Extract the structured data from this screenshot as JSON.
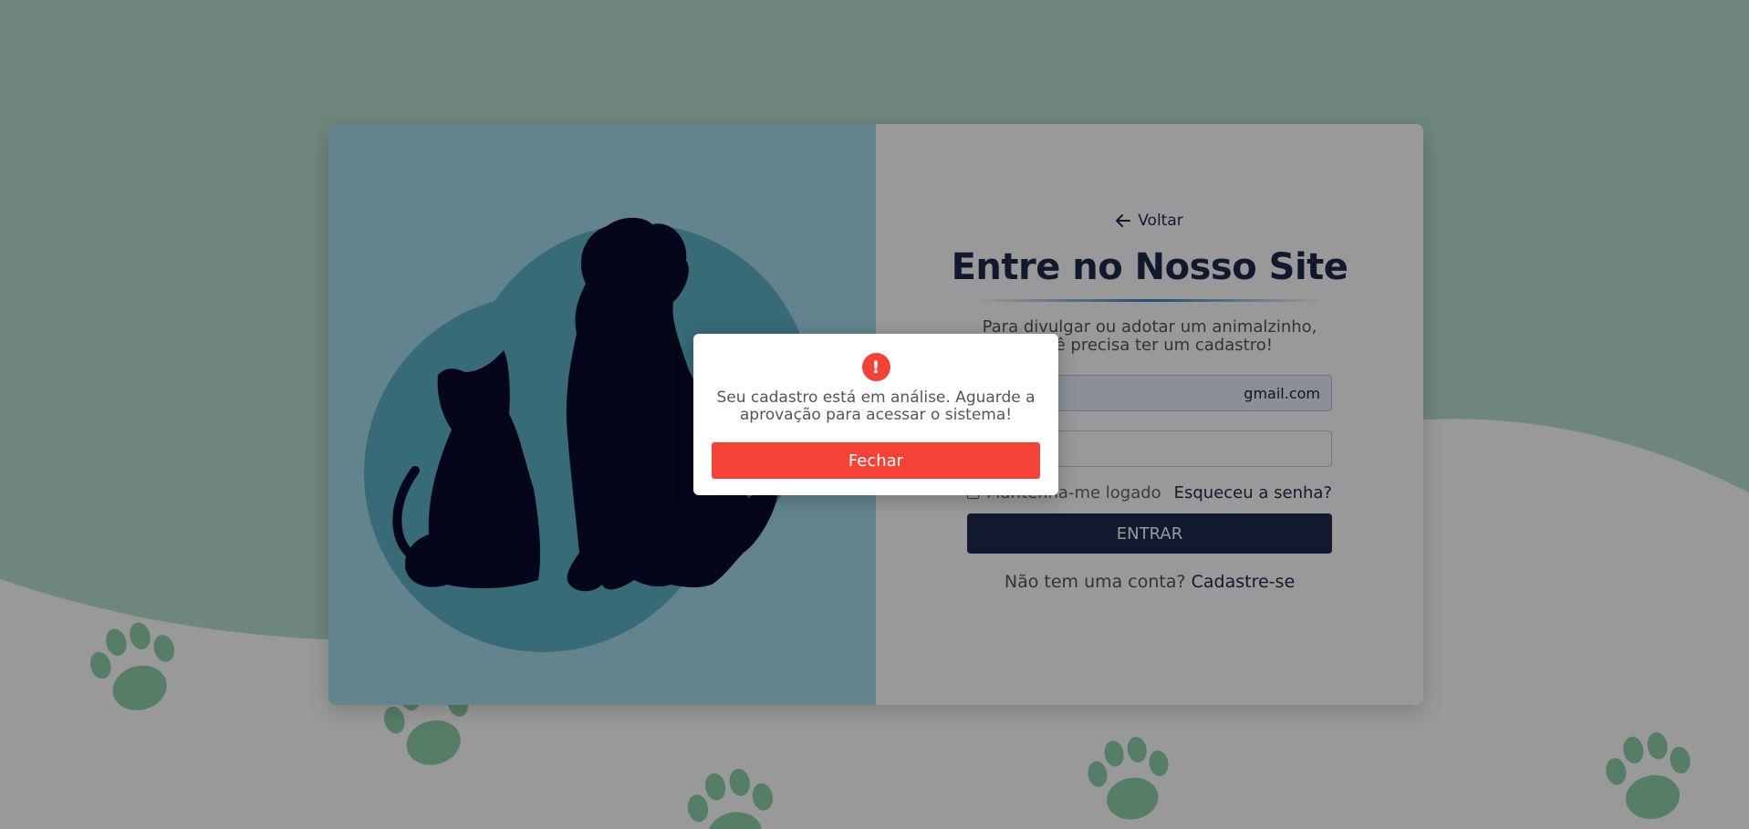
{
  "colors": {
    "wave": "#b8e0cf",
    "paw": "#8fd1ab",
    "card_left_bg": "#a7ddeb",
    "circle": "#5ab3c6",
    "silhouette": "#0a0a2e",
    "brand_navy": "#1b2a4e",
    "alert_red": "#f44336"
  },
  "login": {
    "back_label": "Voltar",
    "back_icon": "arrow-left-icon",
    "title": "Entre no Nosso Site",
    "subtitle": "Para divulgar ou adotar um animalzinho, você precisa ter um cadastro!",
    "email_value": "gmail.com",
    "password_value": "",
    "remember_label": "Mantenha-me logado",
    "forgot_label": "Esqueceu a senha?",
    "enter_label": "ENTRAR",
    "signup_prompt": "Não tem uma conta?",
    "signup_link": "Cadastre-se"
  },
  "illustration": {
    "icon": "cat-and-dog-silhouette"
  },
  "modal": {
    "icon": "alert-exclamation-icon",
    "icon_glyph": "!",
    "message": "Seu cadastro está em análise. Aguarde a aprovação para acessar o sistema!",
    "close_label": "Fechar"
  }
}
